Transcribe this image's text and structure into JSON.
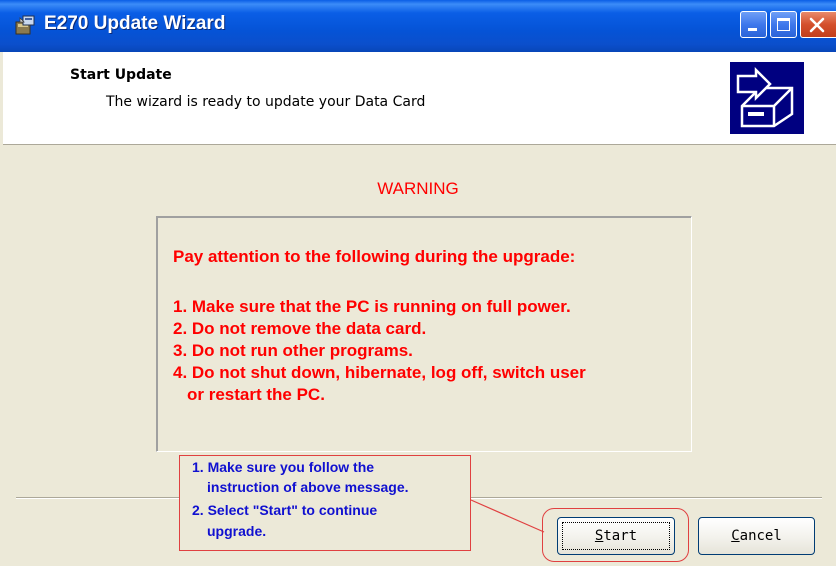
{
  "window": {
    "title": "E270 Update Wizard"
  },
  "header": {
    "title": "Start Update",
    "subtitle": "The wizard is ready to update your Data Card"
  },
  "warning": {
    "title": "WARNING",
    "heading": "Pay attention to the following during the upgrade:",
    "items": [
      "1. Make sure that the PC is running on full power.",
      "2. Do not remove the data card.",
      "3. Do not run other programs.",
      "4. Do not shut down, hibernate, log off, switch user",
      "or restart the PC."
    ]
  },
  "instructions": {
    "lines": [
      "1. Make sure you follow the",
      "instruction of above message.",
      "2. Select \"Start\" to continue",
      "upgrade."
    ]
  },
  "buttons": {
    "start": {
      "mnemonic": "S",
      "rest": "tart"
    },
    "cancel": {
      "mnemonic": "C",
      "rest": "ancel"
    }
  },
  "colors": {
    "titlebar": "#0553d6",
    "warning_text": "#ff0000",
    "instruction_text": "#1010d0",
    "annotation": "#e04040",
    "dialog_bg": "#ece9d8"
  },
  "icons": {
    "app": "installer-icon",
    "header": "drive-install-icon",
    "minimize": "minimize-icon",
    "maximize": "maximize-icon",
    "close": "close-icon"
  }
}
